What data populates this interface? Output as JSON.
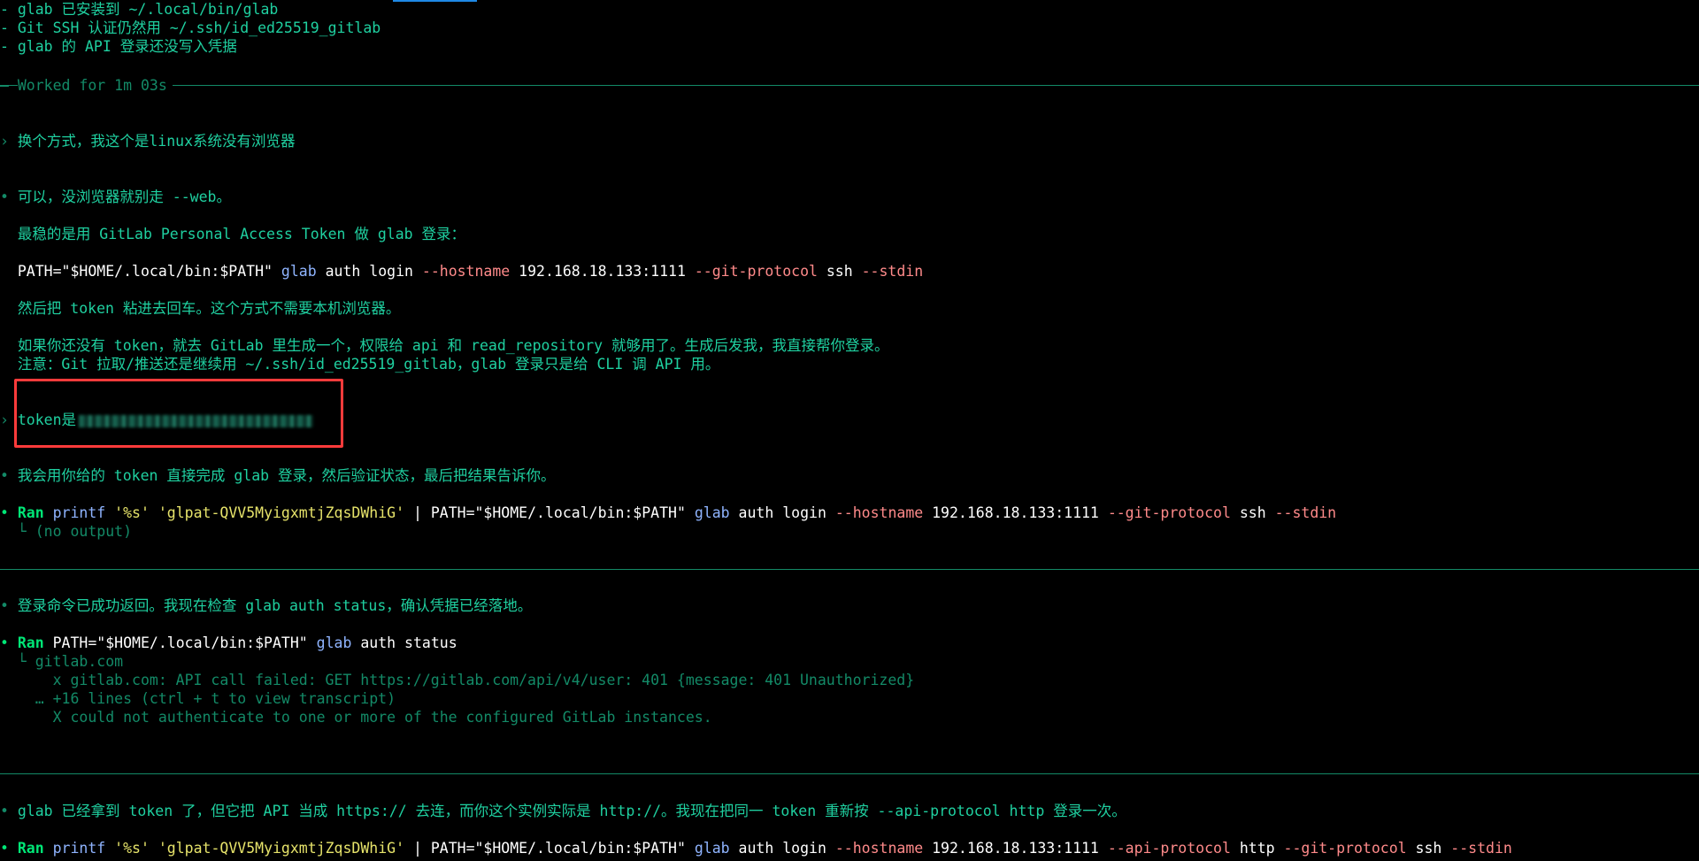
{
  "lines": {
    "l1": "- glab 已安装到 ~/.local/bin/glab",
    "l2": "- Git SSH 认证仍然用 ~/.ssh/id_ed25519_gitlab",
    "l3": "- glab 的 API 登录还没写入凭据",
    "worked": "Worked for 1m 03s",
    "user1": "换个方式，我这个是linux系统没有浏览器",
    "a1": "可以，没浏览器就别走 --web。",
    "a2": "最稳的是用 GitLab Personal Access Token 做 glab 登录：",
    "a4": "然后把 token 粘进去回车。这个方式不需要本机浏览器。",
    "a5": "如果你还没有 token，就去 GitLab 里生成一个，权限给 api 和 read_repository 就够用了。生成后发我，我直接帮你登录。",
    "a6": "注意：Git 拉取/推送还是继续用 ~/.ssh/id_ed25519_gitlab，glab 登录只是给 CLI 调 API 用。",
    "user2": "token是",
    "a7": "我会用你给的 token 直接完成 glab 登录，然后验证状态，最后把结果告诉你。",
    "no_output": "└ (no output)",
    "a8": "登录命令已成功返回。我现在检查 glab auth status，确认凭据已经落地。",
    "o1": "└ gitlab.com",
    "o2": "    x gitlab.com: API call failed: GET https://gitlab.com/api/v4/user: 401 {message: 401 Unauthorized}",
    "o3": "  … +16 lines (ctrl + t to view transcript)",
    "o4": "    X could not authenticate to one or more of the configured GitLab instances.",
    "a9": "glab 已经拿到 token 了，但它把 API 当成 https:// 去连，而你这个实例实际是 http://。我现在把同一 token 重新按 --api-protocol http 登录一次。"
  },
  "tokens": {
    "path": "PATH=\"$HOME/.local/bin:$PATH\"",
    "glab": "glab",
    "auth": "auth",
    "login": "login",
    "status": "status",
    "hostname_flag": "--hostname",
    "host": "192.168.18.133:1111",
    "git_protocol_flag": "--git-protocol",
    "ssh": "ssh",
    "stdin_flag": "--stdin",
    "api_protocol_flag": "--api-protocol",
    "http": "http",
    "ran": "Ran",
    "printf": "printf",
    "fmt": "'%s'",
    "token_str": "'glpat-QVV5MyigxmtjZqsDWhiG'",
    "pipe": "|",
    "bullet": "•",
    "prompt": "›"
  },
  "colors": {
    "background": "#000000",
    "text_green": "#1fd0a0",
    "dim_green": "#138a67",
    "command_white": "#ffffff",
    "command_blue": "#8fb4ff",
    "flag_red": "#ff8a8a",
    "highlight_box": "#ff3b3b"
  }
}
